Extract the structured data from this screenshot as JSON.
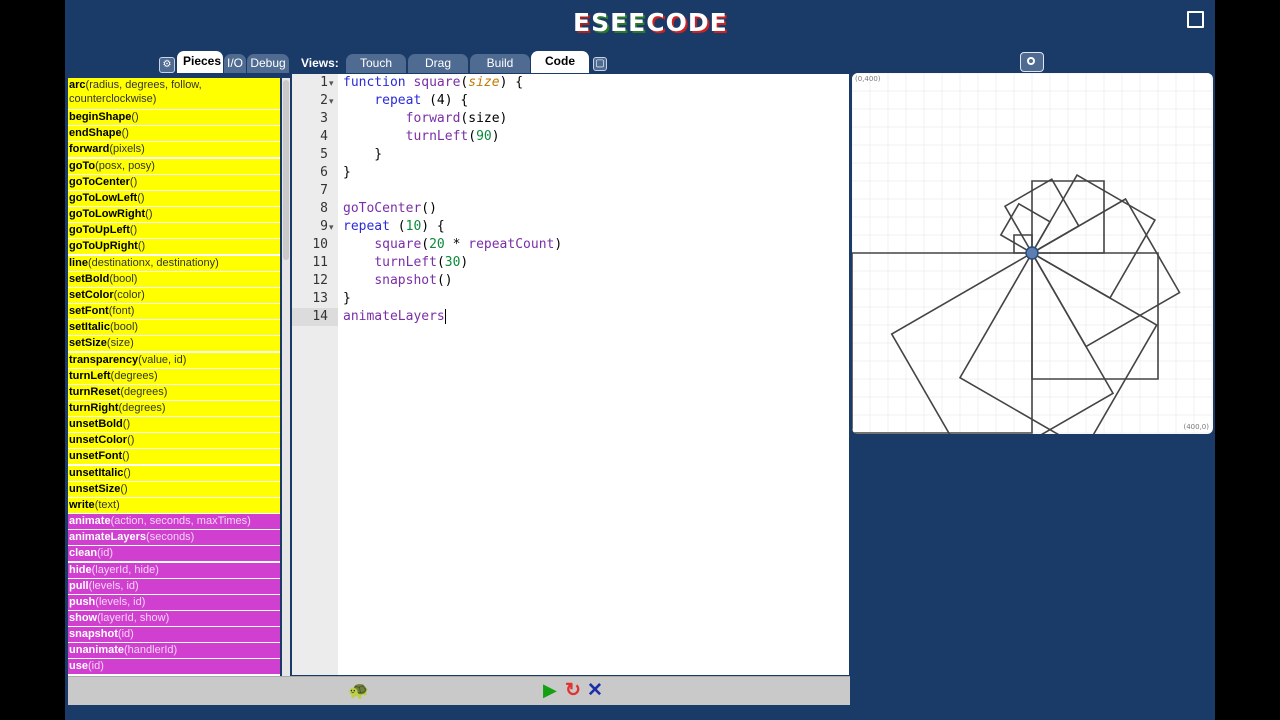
{
  "app": {
    "logo_letters": [
      "E",
      "S",
      "E",
      "E",
      "C",
      "O",
      "D",
      "E"
    ]
  },
  "left_tabs": [
    {
      "label": "Pieces",
      "active": true
    },
    {
      "label": "I/O",
      "active": false
    },
    {
      "label": "Debug",
      "active": false
    }
  ],
  "views": {
    "label": "Views:",
    "tabs": [
      {
        "label": "Touch",
        "active": false
      },
      {
        "label": "Drag",
        "active": false
      },
      {
        "label": "Build",
        "active": false
      },
      {
        "label": "Code",
        "active": true
      }
    ]
  },
  "pieces": {
    "yellow": [
      {
        "name": "arc",
        "params": "(radius, degrees, follow, counterclockwise)"
      },
      {
        "name": "beginShape",
        "params": "()"
      },
      {
        "name": "endShape",
        "params": "()"
      },
      {
        "name": "forward",
        "params": "(pixels)"
      },
      {
        "name": "goTo",
        "params": "(posx, posy)"
      },
      {
        "name": "goToCenter",
        "params": "()"
      },
      {
        "name": "goToLowLeft",
        "params": "()"
      },
      {
        "name": "goToLowRight",
        "params": "()"
      },
      {
        "name": "goToUpLeft",
        "params": "()"
      },
      {
        "name": "goToUpRight",
        "params": "()"
      },
      {
        "name": "line",
        "params": "(destinationx, destinationy)"
      },
      {
        "name": "setBold",
        "params": "(bool)"
      },
      {
        "name": "setColor",
        "params": "(color)"
      },
      {
        "name": "setFont",
        "params": "(font)"
      },
      {
        "name": "setItalic",
        "params": "(bool)"
      },
      {
        "name": "setSize",
        "params": "(size)"
      },
      {
        "name": "transparency",
        "params": "(value, id)"
      },
      {
        "name": "turnLeft",
        "params": "(degrees)"
      },
      {
        "name": "turnReset",
        "params": "(degrees)"
      },
      {
        "name": "turnRight",
        "params": "(degrees)"
      },
      {
        "name": "unsetBold",
        "params": "()"
      },
      {
        "name": "unsetColor",
        "params": "()"
      },
      {
        "name": "unsetFont",
        "params": "()"
      },
      {
        "name": "unsetItalic",
        "params": "()"
      },
      {
        "name": "unsetSize",
        "params": "()"
      },
      {
        "name": "write",
        "params": "(text)"
      }
    ],
    "magenta": [
      {
        "name": "animate",
        "params": "(action, seconds, maxTimes)"
      },
      {
        "name": "animateLayers",
        "params": "(seconds)"
      },
      {
        "name": "clean",
        "params": "(id)"
      },
      {
        "name": "hide",
        "params": "(layerId, hide)"
      },
      {
        "name": "pull",
        "params": "(levels, id)"
      },
      {
        "name": "push",
        "params": "(levels, id)"
      },
      {
        "name": "show",
        "params": "(layerId, show)"
      },
      {
        "name": "snapshot",
        "params": "(id)"
      },
      {
        "name": "unanimate",
        "params": "(handlerId)"
      },
      {
        "name": "use",
        "params": "(id)"
      }
    ]
  },
  "editor": {
    "active_line": 14,
    "lines": [
      {
        "n": "1",
        "fold": true,
        "html": "<span class='kw'>function</span> <span class='fn'>square</span>(<span class='par'>size</span>) {"
      },
      {
        "n": "2",
        "fold": true,
        "html": "    <span class='kw'>repeat</span> (4) {"
      },
      {
        "n": "3",
        "fold": false,
        "html": "        <span class='fn'>forward</span>(size)"
      },
      {
        "n": "4",
        "fold": false,
        "html": "        <span class='fn'>turnLeft</span>(<span class='num'>90</span>)"
      },
      {
        "n": "5",
        "fold": false,
        "html": "    }"
      },
      {
        "n": "6",
        "fold": false,
        "html": "}"
      },
      {
        "n": "7",
        "fold": false,
        "html": ""
      },
      {
        "n": "8",
        "fold": false,
        "html": "<span class='fn'>goToCenter</span>()"
      },
      {
        "n": "9",
        "fold": true,
        "html": "<span class='kw'>repeat</span> (<span class='num'>10</span>) {"
      },
      {
        "n": "10",
        "fold": false,
        "html": "    <span class='fn'>square</span>(<span class='num'>20</span> * <span class='fn'>repeatCount</span>)"
      },
      {
        "n": "11",
        "fold": false,
        "html": "    <span class='fn'>turnLeft</span>(<span class='num'>30</span>)"
      },
      {
        "n": "12",
        "fold": false,
        "html": "    <span class='fn'>snapshot</span>()"
      },
      {
        "n": "13",
        "fold": false,
        "html": "}"
      },
      {
        "n": "14",
        "fold": false,
        "html": "<span class='fn'>animateLayers</span><span class='cursor'></span>"
      }
    ]
  },
  "canvas": {
    "top_left_label": "(0,400)",
    "bottom_right_label": "(400,0)",
    "square_count": 10,
    "angle_step_deg": 30,
    "size_step": 20
  }
}
